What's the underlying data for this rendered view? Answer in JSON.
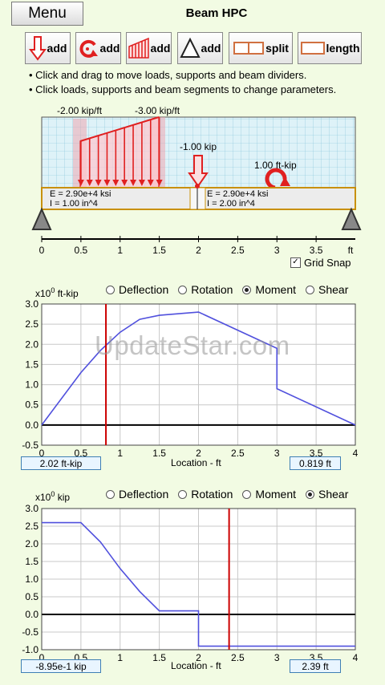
{
  "header": {
    "menu_label": "Menu",
    "title": "Beam HPC"
  },
  "toolbar": {
    "buttons": [
      {
        "name": "add-point-load-button",
        "icon": "down-arrow-icon",
        "label": "add"
      },
      {
        "name": "add-moment-button",
        "icon": "moment-arrow-icon",
        "label": "add"
      },
      {
        "name": "add-distributed-load-button",
        "icon": "distributed-load-icon",
        "label": "add"
      },
      {
        "name": "add-support-button",
        "icon": "triangle-support-icon",
        "label": "add"
      },
      {
        "name": "split-button",
        "icon": "split-segment-icon",
        "label": "split"
      },
      {
        "name": "length-button",
        "icon": "beam-segment-icon",
        "label": "length"
      }
    ]
  },
  "help": [
    "• Click and drag to move loads, supports and beam dividers.",
    "• Click loads, supports and beam segments to change parameters."
  ],
  "beam": {
    "dist_load_start_label": "-2.00 kip/ft",
    "dist_load_end_label": "-3.00 kip/ft",
    "point_load_label": "-1.00 kip",
    "moment_label": "1.00 ft-kip",
    "segment1": {
      "E": "E = 2.90e+4 ksi",
      "I": "I = 1.00 in^4"
    },
    "segment2": {
      "E": "E = 2.90e+4 ksi",
      "I": "I = 2.00 in^4"
    },
    "axis_ticks": [
      "0",
      "0.5",
      "1",
      "1.5",
      "2",
      "2.5",
      "3",
      "3.5",
      "ft"
    ],
    "grid_snap_label": "Grid Snap",
    "grid_snap_checked": true,
    "dist_load": {
      "start_x": 0.5,
      "end_x": 1.5,
      "start_w": -2.0,
      "end_w": -3.0
    },
    "point_load_x": 2.0,
    "moment_x": 3.0,
    "supports_x": [
      0,
      4
    ],
    "divider_x": 2.0
  },
  "radio_options": [
    "Deflection",
    "Rotation",
    "Moment",
    "Shear"
  ],
  "moment_plot": {
    "selected": "Moment",
    "unit_prefix": "x10",
    "unit_exp": "0",
    "unit": "ft-kip",
    "xlabel": "Location - ft",
    "value_readout": "2.02 ft-kip",
    "location_readout": "0.819 ft",
    "cursor_x": 0.819
  },
  "shear_plot": {
    "selected": "Shear",
    "unit_prefix": "x10",
    "unit_exp": "0",
    "unit": "kip",
    "xlabel": "Location - ft",
    "value_readout": "-8.95e-1 kip",
    "location_readout": "2.39 ft",
    "cursor_x": 2.39
  },
  "watermark": "UpdateStar.com",
  "chart_data": [
    {
      "type": "line",
      "title": "Moment",
      "xlabel": "Location - ft",
      "ylabel": "ft-kip",
      "xlim": [
        0,
        4
      ],
      "ylim": [
        -0.5,
        3.0
      ],
      "x_ticks": [
        "0",
        "0.5",
        "1",
        "1.5",
        "2",
        "2.5",
        "3",
        "3.5",
        "4"
      ],
      "y_ticks": [
        "3.0",
        "2.5",
        "2.0",
        "1.5",
        "1.0",
        "0.5",
        "0.0",
        "-0.5"
      ],
      "grid": true,
      "series": [
        {
          "color": "#5050dd",
          "x": [
            0,
            0.5,
            0.75,
            1.0,
            1.25,
            1.5,
            2.0,
            3.0,
            3.0,
            4.0
          ],
          "y": [
            0,
            1.3,
            1.85,
            2.3,
            2.62,
            2.72,
            2.8,
            1.9,
            0.9,
            0
          ]
        }
      ]
    },
    {
      "type": "line",
      "title": "Shear",
      "xlabel": "Location - ft",
      "ylabel": "kip",
      "xlim": [
        0,
        4
      ],
      "ylim": [
        -1.0,
        3.0
      ],
      "x_ticks": [
        "0",
        "0.5",
        "1",
        "1.5",
        "2",
        "2.5",
        "3",
        "3.5",
        "4"
      ],
      "y_ticks": [
        "3.0",
        "2.5",
        "2.0",
        "1.5",
        "1.0",
        "0.5",
        "0.0",
        "-0.5",
        "-1.0"
      ],
      "grid": true,
      "series": [
        {
          "color": "#5050dd",
          "x": [
            0,
            0.5,
            0.75,
            1.0,
            1.25,
            1.5,
            2.0,
            2.0,
            4.0
          ],
          "y": [
            2.6,
            2.6,
            2.05,
            1.3,
            0.65,
            0.1,
            0.1,
            -0.9,
            -0.9
          ]
        }
      ]
    }
  ]
}
